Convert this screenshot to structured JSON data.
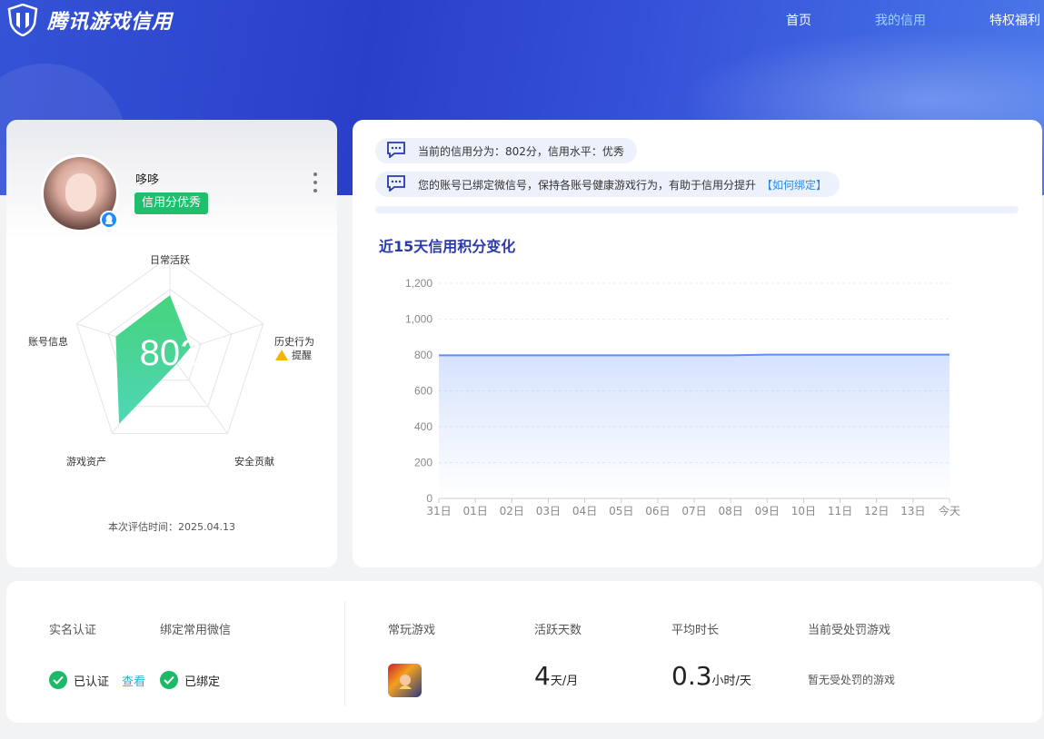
{
  "header": {
    "brand": "腾讯游戏信用",
    "nav": [
      {
        "label": "首页",
        "active": false
      },
      {
        "label": "我的信用",
        "active": true
      },
      {
        "label": "特权福利",
        "active": false
      }
    ]
  },
  "profile": {
    "nickname": "哆哆",
    "credit_tag": "信用分优秀",
    "score": "802",
    "radar_labels": {
      "daily": "日常活跃",
      "history": "历史行为",
      "security": "安全贡献",
      "assets": "游戏资产",
      "account": "账号信息"
    },
    "radar_values": {
      "daily": 0.6,
      "history": 0.22,
      "security": 0.12,
      "assets": 0.88,
      "account": 0.58
    },
    "warning": "提醒",
    "eval_time": "本次评估时间：2025.04.13"
  },
  "notices": [
    {
      "text": "当前的信用分为：802分，信用水平：优秀",
      "link": ""
    },
    {
      "text": "您的账号已绑定微信号，保持各账号健康游戏行为，有助于信用分提升",
      "link": "【如何绑定】"
    }
  ],
  "chart_data": {
    "type": "area",
    "title": "近15天信用积分变化",
    "categories": [
      "31日",
      "01日",
      "02日",
      "03日",
      "04日",
      "05日",
      "06日",
      "07日",
      "08日",
      "09日",
      "10日",
      "11日",
      "12日",
      "13日",
      "今天"
    ],
    "values": [
      798,
      798,
      798,
      798,
      798,
      798,
      798,
      798,
      798,
      802,
      802,
      802,
      802,
      802,
      802
    ],
    "yticks": [
      0,
      200,
      400,
      600,
      800,
      1000,
      1200
    ],
    "ytick_labels": [
      "0",
      "200",
      "400",
      "600",
      "800",
      "1,000",
      "1,200"
    ],
    "ylim": [
      0,
      1200
    ],
    "grid": true,
    "color": "#5b8ff9"
  },
  "bottom": {
    "realname_label": "实名认证",
    "realname_status": "已认证",
    "view_link": "查看",
    "wechat_label": "绑定常用微信",
    "wechat_status": "已绑定",
    "games_label": "常玩游戏",
    "active_label": "活跃天数",
    "active_value": "4",
    "active_unit": "天/月",
    "duration_label": "平均时长",
    "duration_value": "0.3",
    "duration_unit": "小时/天",
    "punish_label": "当前受处罚游戏",
    "punish_status": "暂无受处罚的游戏"
  },
  "colors": {
    "accent_blue": "#2b3aa8",
    "green": "#1db967",
    "link": "#2a8be6"
  }
}
